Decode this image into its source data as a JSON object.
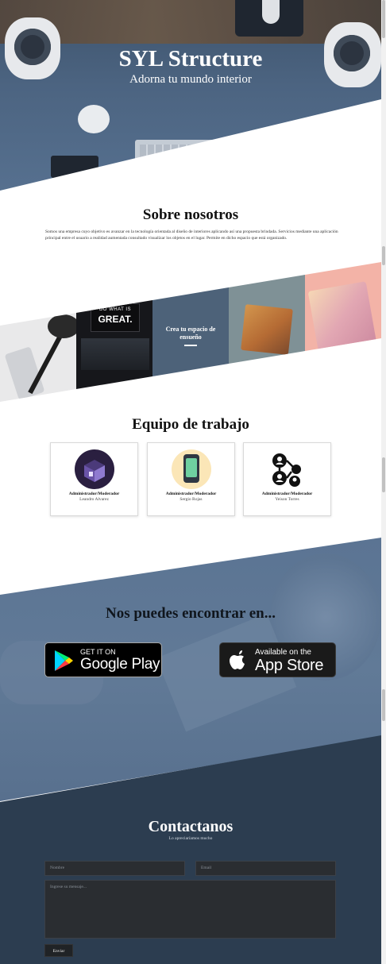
{
  "hero": {
    "title": "SYL Structure",
    "subtitle": "Adorna tu mundo interior"
  },
  "about": {
    "title": "Sobre nosotros",
    "text": "Somos una empresa cuyo objetivo es avanzar en la tecnología orientada al diseño de interiores aplicando así una propuesta brindada. Servicios mediante una aplicación principal entre el usuario a realidad aumentada consultado visualizar los objetos en el lugar. Permite en dicho espacio que está organizado."
  },
  "gallery": {
    "sign_line1": "DO WHAT IS",
    "sign_line2": "GREAT.",
    "cta": "Crea tu espacio de ensueño"
  },
  "team": {
    "title": "Equipo de trabajo",
    "members": [
      {
        "role": "Administrador/Moderador",
        "name": "Leandro Alvarez"
      },
      {
        "role": "Administrador/Moderador",
        "name": "Sergio Rojas"
      },
      {
        "role": "Administrador/Moderador",
        "name": "Yeison Torres"
      }
    ]
  },
  "stores": {
    "title": "Nos puedes encontrar en...",
    "google_play": {
      "small": "GET IT ON",
      "big": "Google Play"
    },
    "app_store": {
      "small": "Available on the",
      "big": "App Store"
    }
  },
  "contact": {
    "title": "Contactanos",
    "subtitle": "Lo apreciaríamos mucho",
    "name_placeholder": "Nombre",
    "email_placeholder": "Email",
    "message_placeholder": "Ingrese su mensaje...",
    "send_label": "Enviar"
  },
  "colors": {
    "hero_overlay": "#4c6481",
    "stores_overlay": "#5b7493",
    "contact_bg": "#2c3d50",
    "gallery_cta_bg": "#4d6279"
  },
  "icons": [
    "google-play-icon",
    "apple-icon",
    "phone-app-icon",
    "network-users-icon"
  ]
}
